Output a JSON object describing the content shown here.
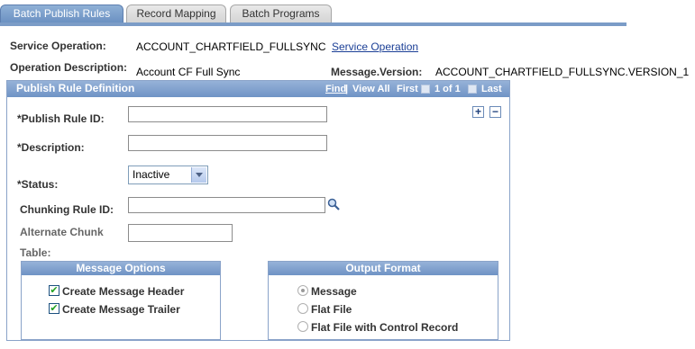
{
  "tabs": [
    {
      "label": "Batch Publish Rules",
      "active": true
    },
    {
      "label": "Record Mapping",
      "active": false
    },
    {
      "label": "Batch Programs",
      "active": false
    }
  ],
  "header": {
    "service_operation_label": "Service Operation:",
    "service_operation_value": "ACCOUNT_CHARTFIELD_FULLSYNC",
    "service_operation_link": "Service Operation",
    "operation_description_label": "Operation Description:",
    "operation_description_value": "Account CF Full Sync",
    "message_version_label": "Message.Version:",
    "message_version_value": "ACCOUNT_CHARTFIELD_FULLSYNC.VERSION_1"
  },
  "group": {
    "title": "Publish Rule Definition",
    "nav": {
      "find": "Find",
      "view_all": "View All",
      "first": "First",
      "range": "1 of 1",
      "last": "Last",
      "separator": "|"
    },
    "add_label": "+",
    "remove_label": "−"
  },
  "fields": {
    "publish_rule_id_label": "*Publish Rule ID:",
    "publish_rule_id_value": "",
    "description_label": "*Description:",
    "description_value": "",
    "status_label": "*Status:",
    "status_value": "Inactive",
    "chunking_rule_label": "Chunking Rule ID:",
    "chunking_rule_value": "",
    "alt_chunk_label_line1": "Alternate Chunk",
    "alt_chunk_label_line2": "Table:",
    "alt_chunk_value": ""
  },
  "message_options": {
    "title": "Message Options",
    "items": [
      {
        "label": "Create Message Header",
        "checked": true
      },
      {
        "label": "Create Message Trailer",
        "checked": true
      }
    ]
  },
  "output_format": {
    "title": "Output Format",
    "items": [
      {
        "label": "Message",
        "selected": true
      },
      {
        "label": "Flat File",
        "selected": false
      },
      {
        "label": "Flat File with Control Record",
        "selected": false
      }
    ]
  },
  "colors": {
    "accent": "#7b9cc7",
    "link": "#1b3f96",
    "check": "#21a121"
  }
}
